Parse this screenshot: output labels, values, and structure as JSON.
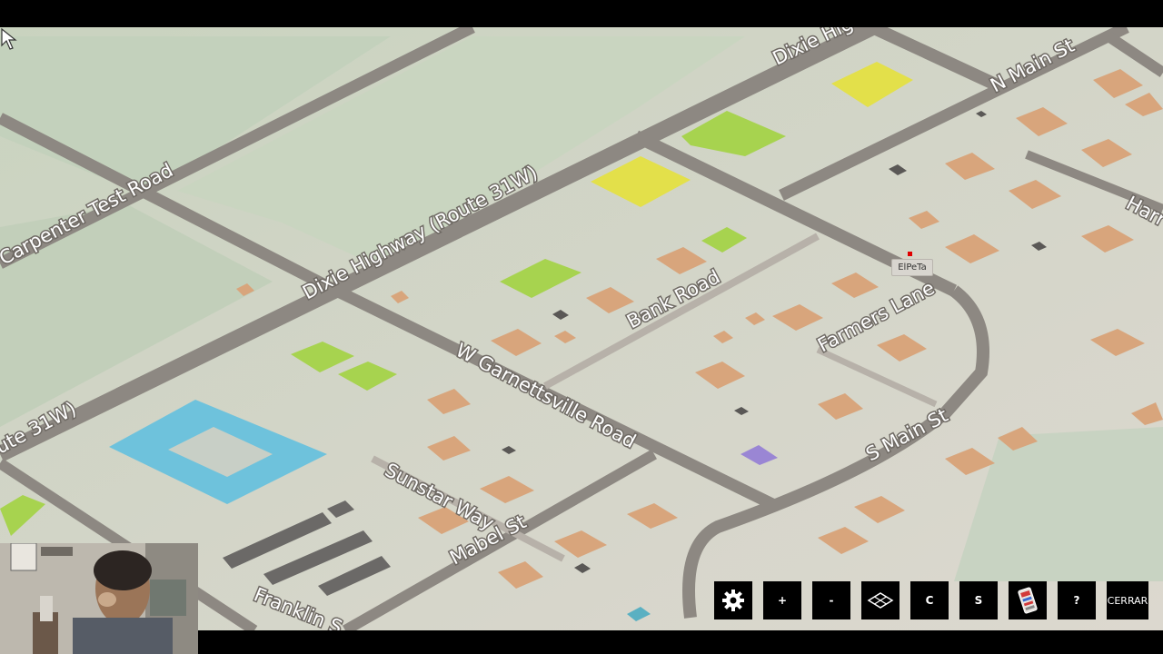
{
  "map": {
    "streets": [
      {
        "id": "carpenter",
        "name": "Carpenter Test Road"
      },
      {
        "id": "dixie_main",
        "name": "Dixie Highway (Route 31W)"
      },
      {
        "id": "dixie_top",
        "name": "Dixie Hig"
      },
      {
        "id": "route_left",
        "name": "ute 31W)"
      },
      {
        "id": "n_main",
        "name": "N Main St"
      },
      {
        "id": "harr",
        "name": "Harr"
      },
      {
        "id": "bank",
        "name": "Bank Road"
      },
      {
        "id": "farmers",
        "name": "Farmers Lane"
      },
      {
        "id": "garnettsville",
        "name": "W Garnettsville Road"
      },
      {
        "id": "s_main",
        "name": "S Main St"
      },
      {
        "id": "sunstar",
        "name": "Sunstar Way"
      },
      {
        "id": "mabel",
        "name": "Mabel St"
      },
      {
        "id": "franklin",
        "name": "Franklin S"
      }
    ],
    "player": {
      "name": "ElPeTa",
      "marker_color": "#e00000"
    },
    "colors": {
      "ground": "#d9d6cb",
      "field": "#c5d2bd",
      "road": "#8d8882",
      "residential": "#d8a57c",
      "commercial_yellow": "#e3e04a",
      "park_green": "#a7d34f",
      "water_blue": "#6ec2dc",
      "purple": "#9a86d4"
    }
  },
  "toolbar": {
    "settings_icon": "gear-icon",
    "zoom_in": "+",
    "zoom_out": "-",
    "layers_icon": "layers-icon",
    "c_label": "C",
    "s_label": "S",
    "card_icon": "card-icon",
    "help": "?",
    "close": "CERRAR"
  },
  "webcam": {
    "icon": "webcam-overlay"
  }
}
